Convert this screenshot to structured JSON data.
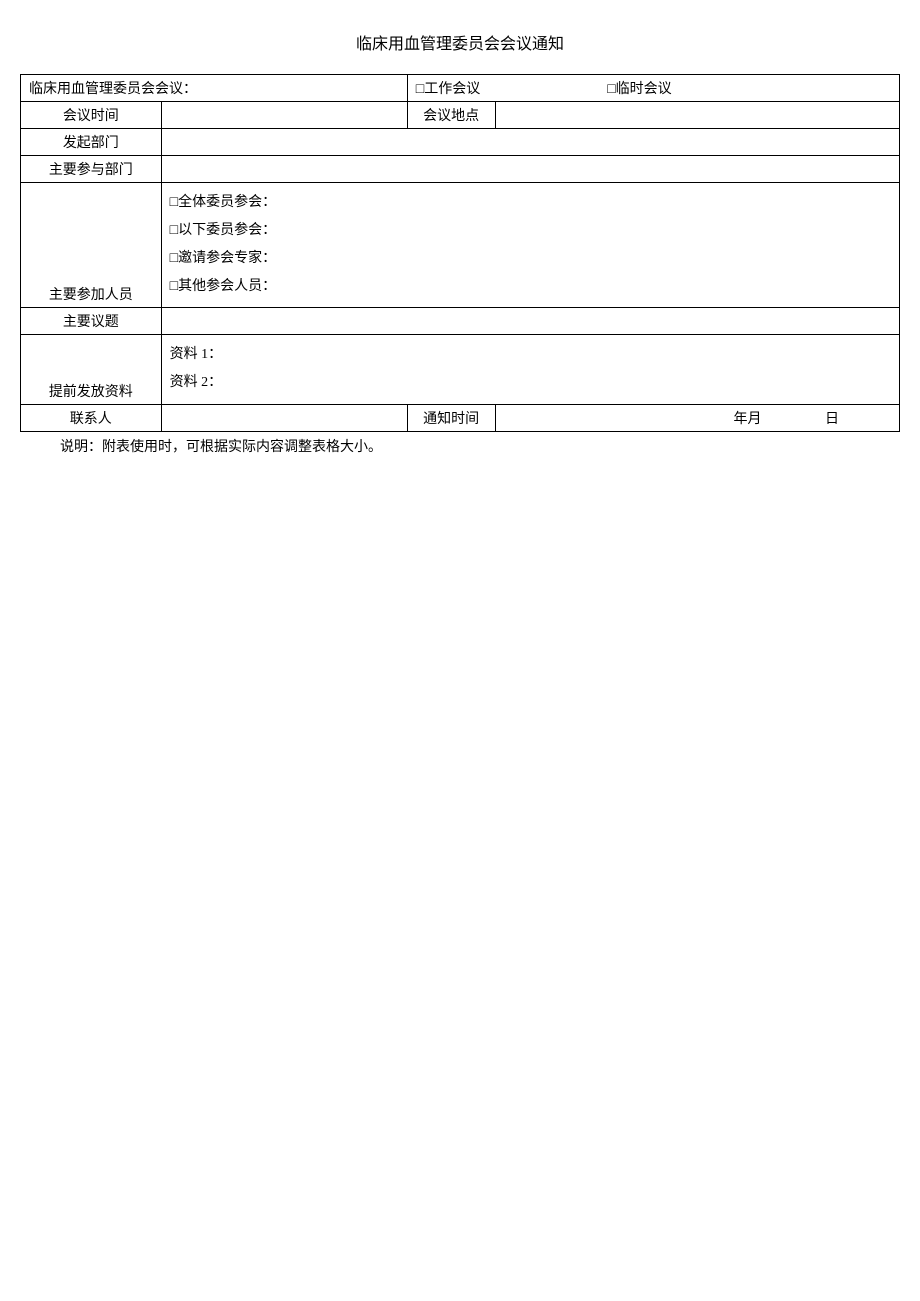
{
  "title": "临床用血管理委员会会议通知",
  "row1": {
    "meetingHeader": "临床用血管理委员会会议：",
    "workMeeting": "□工作会议",
    "tempMeeting": "□临时会议"
  },
  "row2": {
    "meetingTimeLabel": "会议时间",
    "meetingLocationLabel": "会议地点"
  },
  "row3": {
    "sponsorDeptLabel": "发起部门"
  },
  "row4": {
    "participatingDeptLabel": "主要参与部门"
  },
  "row5": {
    "participantsLabel": "主要参加人员",
    "allMembers": "□全体委员参会：",
    "followingMembers": "□以下委员参会：",
    "invitedExperts": "□邀请参会专家：",
    "otherAttendees": "□其他参会人员："
  },
  "row6": {
    "mainTopicsLabel": "主要议题"
  },
  "row7": {
    "materialsLabel": "提前发放资料",
    "material1": "资料 1：",
    "material2": "资料 2："
  },
  "row8": {
    "contactLabel": "联系人",
    "noticeTimeLabel": "通知时间",
    "yearMonth": "年月",
    "day": "日"
  },
  "note": "说明：附表使用时，可根据实际内容调整表格大小。"
}
